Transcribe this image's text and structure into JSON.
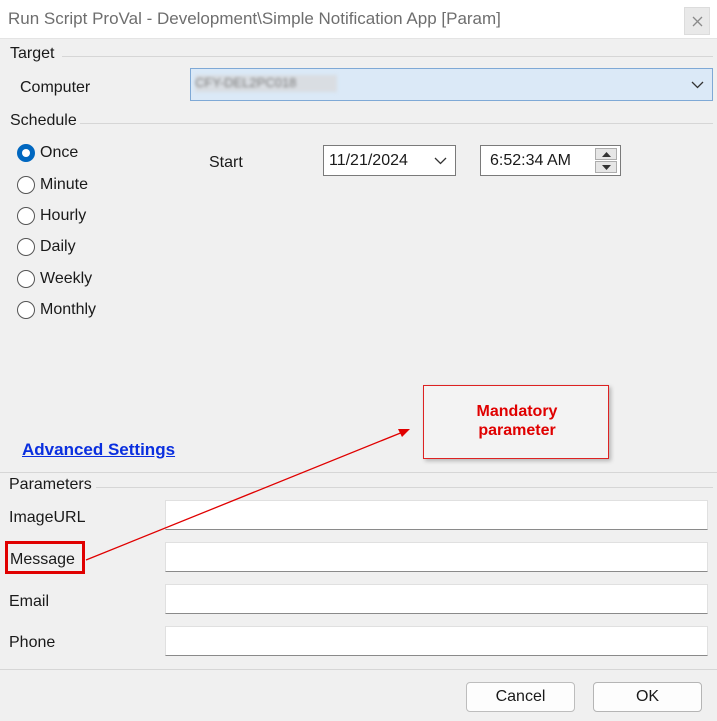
{
  "window": {
    "title": "Run Script ProVal - Development\\Simple Notification App [Param]",
    "close_icon": "close-icon"
  },
  "target": {
    "section_label": "Target",
    "computer_label": "Computer",
    "computer_value": "CFY-DEL2PC018"
  },
  "schedule": {
    "section_label": "Schedule",
    "options": [
      "Once",
      "Minute",
      "Hourly",
      "Daily",
      "Weekly",
      "Monthly"
    ],
    "selected": "Once",
    "start_label": "Start",
    "start_date": "11/21/2024",
    "start_time": "6:52:34 AM"
  },
  "advanced_settings_link": "Advanced Settings",
  "parameters": {
    "section_label": "Parameters",
    "fields": [
      {
        "label": "ImageURL",
        "value": ""
      },
      {
        "label": "Message",
        "value": ""
      },
      {
        "label": "Email",
        "value": ""
      },
      {
        "label": "Phone",
        "value": ""
      }
    ]
  },
  "buttons": {
    "cancel": "Cancel",
    "ok": "OK"
  },
  "annotation": {
    "callout_line1": "Mandatory",
    "callout_line2": "parameter",
    "color": "#e00000"
  },
  "colors": {
    "accent": "#0067c0",
    "link": "#0a2fdf",
    "background": "#f0f0f0"
  }
}
